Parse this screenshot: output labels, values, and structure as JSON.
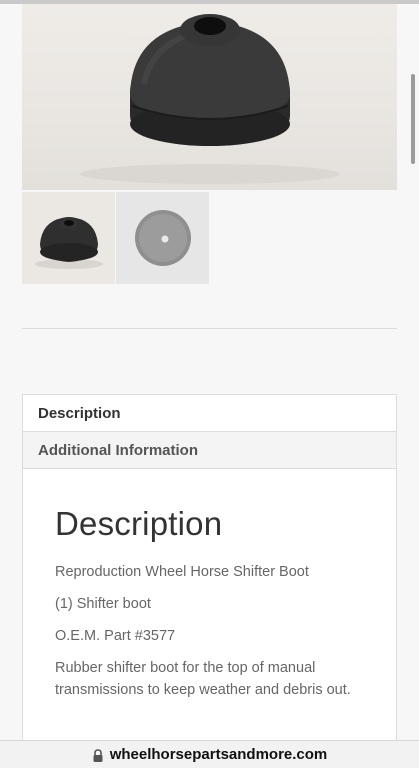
{
  "gallery": {
    "main_image_alt": "",
    "thumbnails": [
      {
        "alt": "",
        "selected": true
      },
      {
        "alt": "",
        "selected": false
      }
    ]
  },
  "tabs": [
    {
      "label": "Description",
      "active": true
    },
    {
      "label": "Additional Information",
      "active": false
    }
  ],
  "description": {
    "heading": "Description",
    "lines": [
      "Reproduction Wheel Horse Shifter Boot",
      "(1) Shifter boot",
      "O.E.M. Part #3577",
      "Rubber shifter boot for the top of manual transmissions to keep weather and debris out."
    ]
  },
  "browser": {
    "url": "wheelhorsepartsandmore.com",
    "lock_icon": "lock-icon"
  },
  "colors": {
    "page_bg": "#f7f7f7",
    "text": "#333333",
    "muted_text": "#666666",
    "border": "#dcdcdc"
  }
}
